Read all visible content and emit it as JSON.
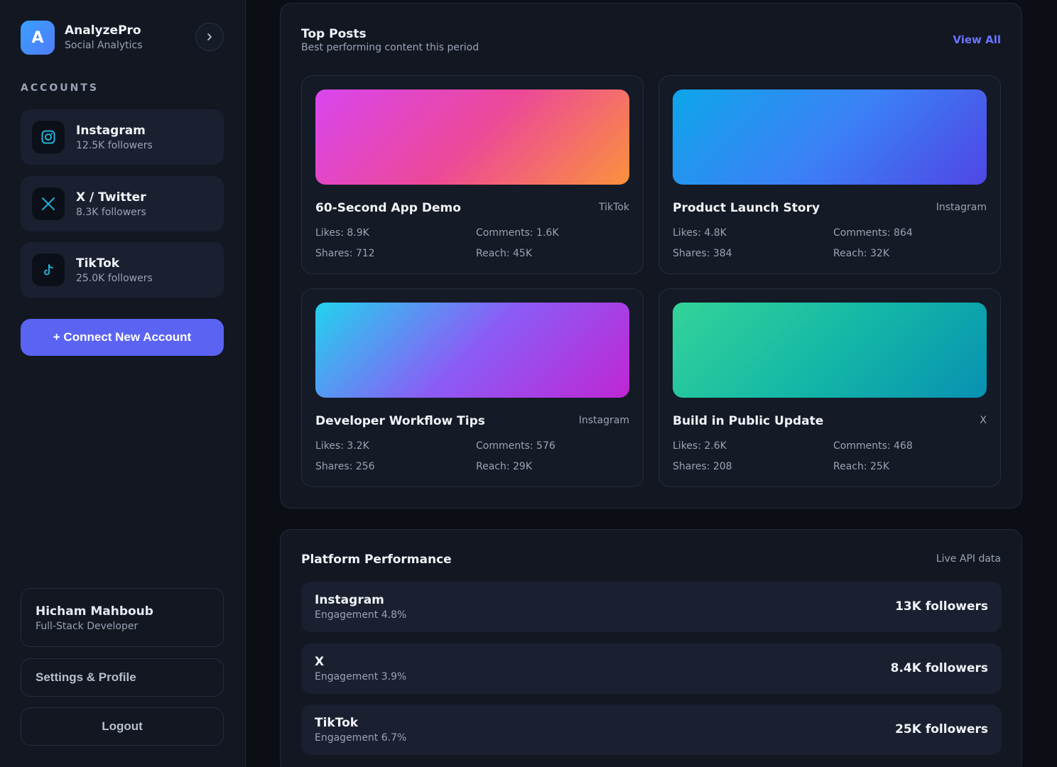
{
  "brand": {
    "logo_letter": "A",
    "name": "AnalyzePro",
    "subtitle": "Social Analytics"
  },
  "sidebar": {
    "accounts_title": "ACCOUNTS",
    "accounts": [
      {
        "name": "Instagram",
        "followers": "12.5K followers",
        "icon": "instagram-icon"
      },
      {
        "name": "X / Twitter",
        "followers": "8.3K followers",
        "icon": "x-icon"
      },
      {
        "name": "TikTok",
        "followers": "25.0K followers",
        "icon": "tiktok-icon"
      }
    ],
    "connect_label": "+ Connect New Account",
    "user": {
      "name": "Hicham Mahboub",
      "role": "Full-Stack Developer"
    },
    "settings_label": "Settings & Profile",
    "logout_label": "Logout"
  },
  "top_posts": {
    "title": "Top Posts",
    "subtitle": "Best performing content this period",
    "view_all": "View All",
    "posts": [
      {
        "title": "60-Second App Demo",
        "platform": "TikTok",
        "likes": "Likes: 8.9K",
        "comments": "Comments: 1.6K",
        "shares": "Shares: 712",
        "reach": "Reach: 45K",
        "gradient": [
          "#d946ef",
          "#ec4899",
          "#fb923c"
        ]
      },
      {
        "title": "Product Launch Story",
        "platform": "Instagram",
        "likes": "Likes: 4.8K",
        "comments": "Comments: 864",
        "shares": "Shares: 384",
        "reach": "Reach: 32K",
        "gradient": [
          "#0ea5e9",
          "#3b82f6",
          "#4f46e5"
        ]
      },
      {
        "title": "Developer Workflow Tips",
        "platform": "Instagram",
        "likes": "Likes: 3.2K",
        "comments": "Comments: 576",
        "shares": "Shares: 256",
        "reach": "Reach: 29K",
        "gradient": [
          "#22d3ee",
          "#8b5cf6",
          "#c026d3"
        ]
      },
      {
        "title": "Build in Public Update",
        "platform": "X",
        "likes": "Likes: 2.6K",
        "comments": "Comments: 468",
        "shares": "Shares: 208",
        "reach": "Reach: 25K",
        "gradient": [
          "#34d399",
          "#14b8a6",
          "#0891b2"
        ]
      }
    ]
  },
  "platform_performance": {
    "title": "Platform Performance",
    "note": "Live API data",
    "rows": [
      {
        "name": "Instagram",
        "engagement": "Engagement 4.8%",
        "followers": "13K followers"
      },
      {
        "name": "X",
        "engagement": "Engagement 3.9%",
        "followers": "8.4K followers"
      },
      {
        "name": "TikTok",
        "engagement": "Engagement 6.7%",
        "followers": "25K followers"
      }
    ]
  },
  "colors": {
    "accent": "#5b64f2",
    "link": "#6b73ff",
    "icon_accent": "#22c3ee"
  }
}
